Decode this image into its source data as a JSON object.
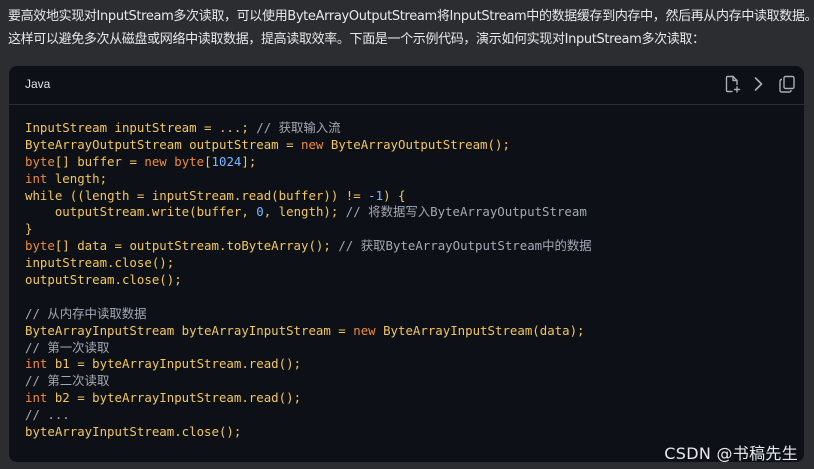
{
  "intro": {
    "line1": "要高效地实现对InputStream多次读取，可以使用ByteArrayOutputStream将InputStream中的数据缓存到内存中，然后再从内存中读取数据。",
    "line2": "这样可以避免多次从磁盘或网络中读取数据，提高读取效率。下面是一个示例代码，演示如何实现对InputStream多次读取："
  },
  "code_block": {
    "language": "Java",
    "toolbar": [
      {
        "icon": "insert-file-icon"
      },
      {
        "icon": "chevron-right-icon"
      },
      {
        "icon": "copy-icon"
      }
    ],
    "lines": [
      [
        {
          "t": "InputStream inputStream = ...;",
          "c": "t-type"
        },
        {
          "t": " // 获取输入流",
          "c": "t-com"
        }
      ],
      [
        {
          "t": "ByteArrayOutputStream outputStream = ",
          "c": "t-type"
        },
        {
          "t": "new",
          "c": "t-kw"
        },
        {
          "t": " ByteArrayOutputStream();",
          "c": "t-type"
        }
      ],
      [
        {
          "t": "byte",
          "c": "t-kw"
        },
        {
          "t": "[] buffer = ",
          "c": "t-type"
        },
        {
          "t": "new",
          "c": "t-kw"
        },
        {
          "t": " ",
          "c": "t-type"
        },
        {
          "t": "byte",
          "c": "t-kw"
        },
        {
          "t": "[",
          "c": "t-type"
        },
        {
          "t": "1024",
          "c": "t-num"
        },
        {
          "t": "];",
          "c": "t-type"
        }
      ],
      [
        {
          "t": "int",
          "c": "t-kw"
        },
        {
          "t": " length;",
          "c": "t-type"
        }
      ],
      [
        {
          "t": "while",
          "c": "t-type"
        },
        {
          "t": " ((length = inputStream.read(buffer)) != ",
          "c": "t-type"
        },
        {
          "t": "-1",
          "c": "t-num"
        },
        {
          "t": ") {",
          "c": "t-type"
        }
      ],
      [
        {
          "t": "    outputStream.write(buffer, ",
          "c": "t-type"
        },
        {
          "t": "0",
          "c": "t-num"
        },
        {
          "t": ", length);",
          "c": "t-type"
        },
        {
          "t": " // 将数据写入ByteArrayOutputStream",
          "c": "t-com"
        }
      ],
      [
        {
          "t": "}",
          "c": "t-type"
        }
      ],
      [
        {
          "t": "byte",
          "c": "t-kw"
        },
        {
          "t": "[] data = outputStream.toByteArray();",
          "c": "t-type"
        },
        {
          "t": " // 获取ByteArrayOutputStream中的数据",
          "c": "t-com"
        }
      ],
      [
        {
          "t": "inputStream.close();",
          "c": "t-type"
        }
      ],
      [
        {
          "t": "outputStream.close();",
          "c": "t-type"
        }
      ],
      [],
      [
        {
          "t": "// 从内存中读取数据",
          "c": "t-com"
        }
      ],
      [
        {
          "t": "ByteArrayInputStream byteArrayInputStream = ",
          "c": "t-type"
        },
        {
          "t": "new",
          "c": "t-kw"
        },
        {
          "t": " ByteArrayInputStream(data);",
          "c": "t-type"
        }
      ],
      [
        {
          "t": "// 第一次读取",
          "c": "t-com"
        }
      ],
      [
        {
          "t": "int",
          "c": "t-kw"
        },
        {
          "t": " b1 = byteArrayInputStream.read();",
          "c": "t-type"
        }
      ],
      [
        {
          "t": "// 第二次读取",
          "c": "t-com"
        }
      ],
      [
        {
          "t": "int",
          "c": "t-kw"
        },
        {
          "t": " b2 = byteArrayInputStream.read();",
          "c": "t-type"
        }
      ],
      [
        {
          "t": "// ...",
          "c": "t-com"
        }
      ],
      [
        {
          "t": "byteArrayInputStream.close();",
          "c": "t-type"
        }
      ]
    ]
  },
  "watermark": "CSDN @书稿先生",
  "colors": {
    "background": "#2b2d31",
    "code_background": "#0d1117",
    "code_text": "#f2c75a",
    "keyword": "#f08a3a",
    "number": "#79b8ff",
    "comment": "#a3a8b4"
  }
}
